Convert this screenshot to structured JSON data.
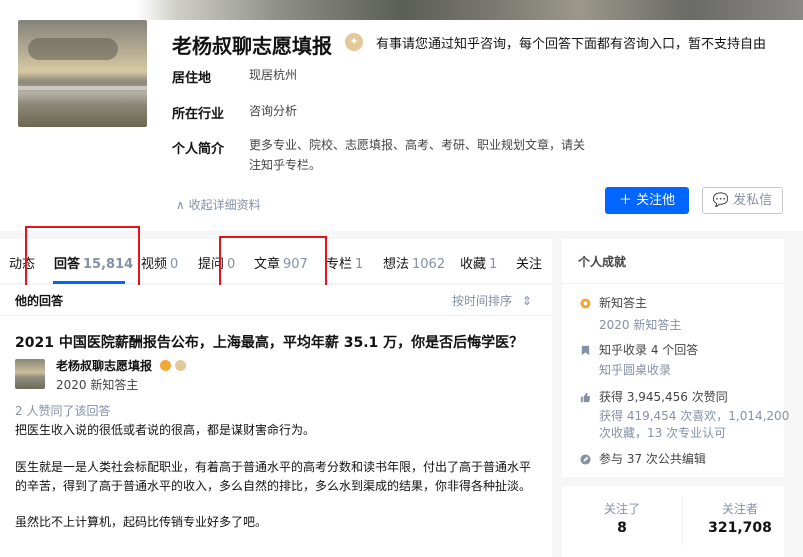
{
  "profile": {
    "name": "老杨叔聊志愿填报",
    "headline": "有事请您通过知乎咨询，每个回答下面都有咨询入口，暂不支持自由",
    "fields": [
      {
        "label": "居住地",
        "value": "现居杭州"
      },
      {
        "label": "所在行业",
        "value": "咨询分析"
      },
      {
        "label": "个人简介",
        "value": "更多专业、院校、志愿填报、高考、考研、职业规划文章，请关注知乎专栏。"
      }
    ],
    "collapse_label": "收起详细资料",
    "follow_button": "关注他",
    "message_button": "发私信"
  },
  "tabs": [
    {
      "label": "动态",
      "count": ""
    },
    {
      "label": "回答",
      "count": "15,814"
    },
    {
      "label": "视频",
      "count": "0"
    },
    {
      "label": "提问",
      "count": "0"
    },
    {
      "label": "文章",
      "count": "907"
    },
    {
      "label": "专栏",
      "count": "1"
    },
    {
      "label": "想法",
      "count": "1062"
    },
    {
      "label": "收藏",
      "count": "1"
    },
    {
      "label": "关注",
      "count": ""
    }
  ],
  "answers": {
    "header": "他的回答",
    "sort_label": "按时间排序",
    "item": {
      "question": "2021 中国医院薪酬报告公布，上海最高，平均年薪 35.1 万，你是否后悔学医？",
      "author_name": "老杨叔聊志愿填报",
      "author_sub": "2020 新知答主",
      "likes": "2 人赞同了该回答",
      "paragraphs": [
        "把医生收入说的很低或者说的很高，都是谋财害命行为。",
        "医生就是一是人类社会标配职业，有着高于普通水平的高考分数和读书年限，付出了高于普通水平的辛苦，得到了高于普通水平的收入，多么自然的排比，多么水到渠成的结果，你非得各种扯淡。",
        "虽然比不上计算机，起码比传销专业好多了吧。"
      ]
    }
  },
  "achievements": {
    "title": "个人成就",
    "items": [
      {
        "icon": "badge-icon",
        "line1": "新知答主",
        "line2": "2020 新知答主"
      },
      {
        "icon": "bookmark-icon",
        "line1": "知乎收录 4 个回答",
        "line2": "知乎圆桌收录"
      },
      {
        "icon": "thumbs-up-icon",
        "line1": "获得 3,945,456 次赞同",
        "line2": "获得 419,454 次喜欢，1,014,200",
        "line3": "次收藏，13 次专业认可"
      },
      {
        "icon": "edit-icon",
        "line1": "参与 37 次公共编辑"
      }
    ]
  },
  "follow_stats": {
    "following_label": "关注了",
    "following_value": "8",
    "followers_label": "关注者",
    "followers_value": "321,708"
  },
  "colors": {
    "accent": "#0066ff",
    "highlight": "#e4131c",
    "muted": "#8590a6",
    "badge": "#f0a934"
  }
}
